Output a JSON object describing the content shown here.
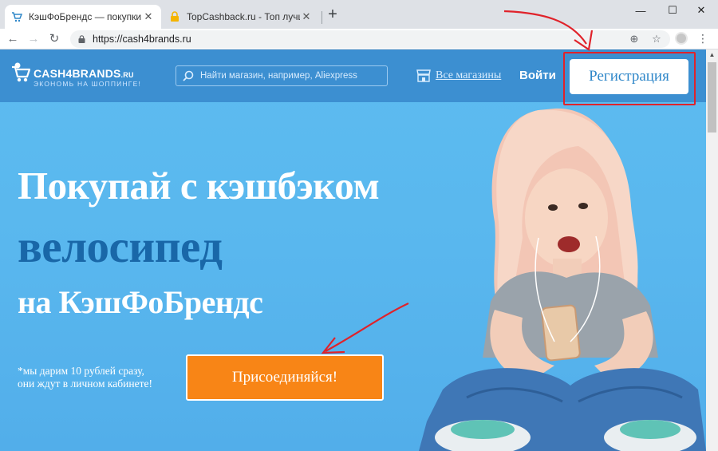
{
  "browser": {
    "tabs": [
      {
        "title": "КэшФоБрендс — покупки с кэш",
        "active": true
      },
      {
        "title": "TopCashback.ru - Топ лучших кэ",
        "active": false
      }
    ],
    "new_tab_icon": "plus-icon",
    "window_controls": {
      "minimize": "—",
      "maximize": "☐",
      "close": "✕"
    },
    "address": "https://cash4brands.ru",
    "nav": {
      "back": "←",
      "forward": "→",
      "reload": "↻"
    }
  },
  "header": {
    "logo_name": "CASH4BRANDS",
    "logo_tld": ".RU",
    "logo_tagline": "ЭКОНОМЬ НА ШОППИНГЕ!",
    "search_placeholder": "Найти магазин, например, Aliexpress",
    "all_stores": "Все магазины",
    "login": "Войти",
    "register": "Регистрация"
  },
  "hero": {
    "line1": "Покупай с кэшбэком",
    "line2": "велосипед",
    "line3": "на КэшФоБрендс",
    "note_line1": "*мы дарим 10 рублей сразу,",
    "note_line2": "они ждут в личном кабинете!",
    "cta": "Присоединяйся!"
  },
  "colors": {
    "header_bg": "#3c8fd1",
    "hero_bg": "#5dbcf0",
    "accent_dark_blue": "#1967a8",
    "cta_orange": "#f88516",
    "annotation_red": "#e0222a"
  }
}
